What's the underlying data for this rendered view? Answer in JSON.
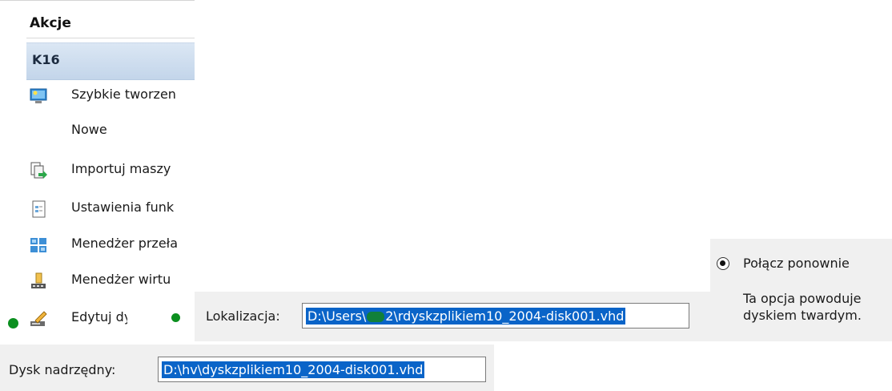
{
  "actions": {
    "header": "Akcje",
    "group": "K16",
    "items": [
      {
        "label": "Szybkie tworzen",
        "icon": "monitor-icon"
      },
      {
        "label": "Nowe",
        "icon": ""
      },
      {
        "label": "Importuj maszy",
        "icon": "import-icon"
      },
      {
        "label": "Ustawienia funk",
        "icon": "settings-document-icon"
      },
      {
        "label": "Menedżer przeła",
        "icon": "switch-manager-icon"
      },
      {
        "label": "Menedżer wirtu",
        "icon": "san-manager-icon"
      },
      {
        "label": "Edytuj dysk...",
        "icon": "edit-disk-icon"
      }
    ]
  },
  "location": {
    "label": "Lokalizacja:",
    "value_prefix": "D:\\Users\\",
    "value_mid": "2\\",
    "value_suffix": "rdyskzplikiem10_2004-disk001.vhd"
  },
  "reconnect": {
    "option_label": "Połącz ponownie",
    "description_line1": "Ta opcja powoduje",
    "description_line2": "dyskiem twardym."
  },
  "parent_disk": {
    "label": "Dysk nadrzędny:",
    "value": "D:\\hv\\dyskzplikiem10_2004-disk001.vhd"
  },
  "colors": {
    "selection": "#0a64c8",
    "group_row": "#c3d5ea",
    "annotation_dot": "#0b8f1f"
  }
}
